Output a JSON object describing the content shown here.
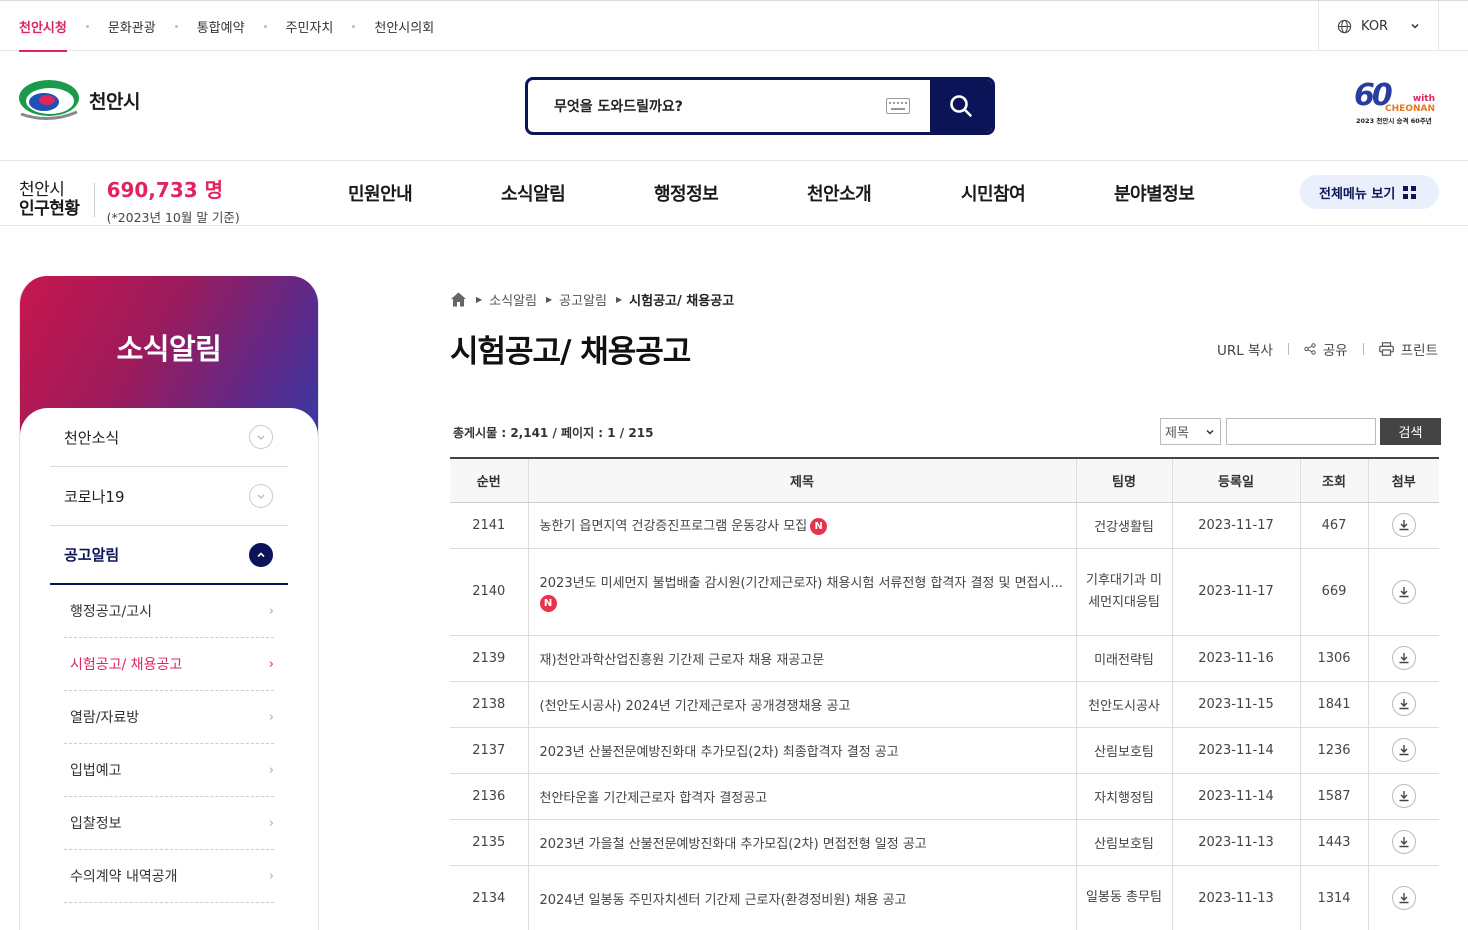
{
  "topnav": [
    "천안시청",
    "문화관광",
    "통합예약",
    "주민자치",
    "천안시의회"
  ],
  "lang": "KOR",
  "logo_text": "천안시",
  "search": {
    "placeholder": "무엇을 도와드릴까요?"
  },
  "anniversary": {
    "num": "60",
    "with": "with",
    "city": "CHEONAN",
    "sub": "2023 천안시 승격 60주년"
  },
  "population": {
    "title_line1": "천안시",
    "title_line2": "인구현황",
    "count": "690,733 명",
    "note": "(*2023년 10월 말 기준)"
  },
  "mainmenu": [
    "민원안내",
    "소식알림",
    "행정정보",
    "천안소개",
    "시민참여",
    "분야별정보"
  ],
  "allmenu_label": "전체메뉴 보기",
  "sidebar": {
    "title": "소식알림",
    "categories": [
      "천안소식",
      "코로나19",
      "공고알림"
    ],
    "subs": [
      "행정공고/고시",
      "시험공고/ 채용공고",
      "열람/자료방",
      "입법예고",
      "입찰정보",
      "수의계약 내역공개"
    ]
  },
  "breadcrumb": [
    "소식알림",
    "공고알림",
    "시험공고/ 채용공고"
  ],
  "page_title": "시험공고/ 채용공고",
  "tools": {
    "url_copy": "URL 복사",
    "share": "공유",
    "print": "프린트"
  },
  "board": {
    "count_text": "총게시물 : 2,141 / 페이지 : 1 / 215",
    "search_select": "제목",
    "search_button": "검색",
    "headers": [
      "순번",
      "제목",
      "팀명",
      "등록일",
      "조회",
      "첨부"
    ],
    "rows": [
      {
        "no": "2141",
        "title": "농한기 읍면지역 건강증진프로그램 운동강사 모집",
        "team": "건강생활팀",
        "date": "2023-11-17",
        "views": "467",
        "new": "N"
      },
      {
        "no": "2140",
        "title": "2023년도 미세먼지 불법배출 감시원(기간제근로자) 채용시험 서류전형 합격자 결정 및 면접시...",
        "team": "기후대기과 미세먼지대응팀",
        "date": "2023-11-17",
        "views": "669",
        "new": "N"
      },
      {
        "no": "2139",
        "title": "재)천안과학산업진흥원 기간제 근로자 채용 재공고문",
        "team": "미래전략팀",
        "date": "2023-11-16",
        "views": "1306"
      },
      {
        "no": "2138",
        "title": "(천안도시공사) 2024년 기간제근로자 공개경쟁채용 공고",
        "team": "천안도시공사",
        "date": "2023-11-15",
        "views": "1841"
      },
      {
        "no": "2137",
        "title": "2023년 산불전문예방진화대 추가모집(2차) 최종합격자 결정 공고",
        "team": "산림보호팀",
        "date": "2023-11-14",
        "views": "1236"
      },
      {
        "no": "2136",
        "title": "천안타운홀 기간제근로자 합격자 결정공고",
        "team": "자치행정팀",
        "date": "2023-11-14",
        "views": "1587"
      },
      {
        "no": "2135",
        "title": "2023년 가을철 산불전문예방진화대 추가모집(2차) 면접전형 일정 공고",
        "team": "산림보호팀",
        "date": "2023-11-13",
        "views": "1443"
      },
      {
        "no": "2134",
        "title": "2024년 일봉동 주민자치센터 기간제 근로자(환경정비원) 채용 공고",
        "team": "일봉동 총무팀",
        "date": "2023-11-13",
        "views": "1314"
      }
    ]
  },
  "colors": {
    "navy": "#0a1457",
    "accent": "#e0245e"
  }
}
